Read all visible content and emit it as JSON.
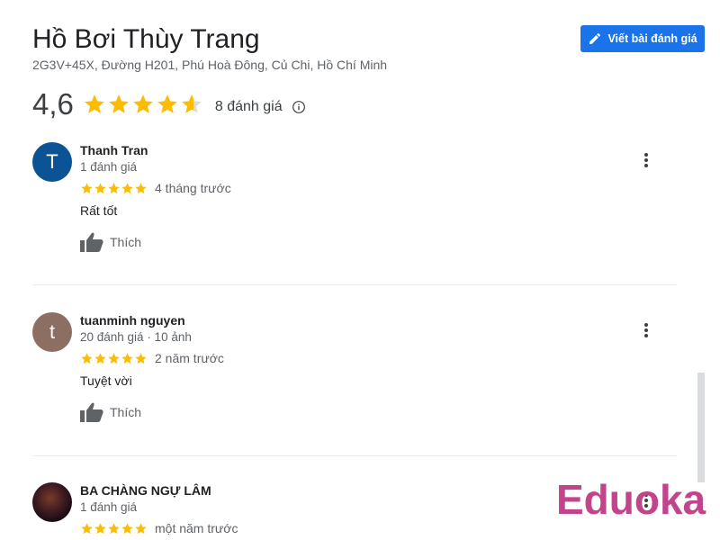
{
  "place": {
    "title": "Hồ Bơi Thùy Trang",
    "address": "2G3V+45X, Đường H201, Phú Hoà Đông, Củ Chi, Hồ Chí Minh"
  },
  "write_review_label": "Viết bài đánh giá",
  "rating": {
    "value_text": "4,6",
    "value": 4.6,
    "max": 5,
    "count_label": "8 đánh giá"
  },
  "like_label": "Thích",
  "reviews": [
    {
      "avatar_letter": "T",
      "avatar_color": "#0b5394",
      "name": "Thanh Tran",
      "meta": "1 đánh giá",
      "stars": 5,
      "time": "4 tháng trước",
      "text": "Rất tốt"
    },
    {
      "avatar_letter": "t",
      "avatar_color": "#8d6e63",
      "name": "tuanminh nguyen",
      "meta": "20 đánh giá · 10 ảnh",
      "stars": 5,
      "time": "2 năm trước",
      "text": "Tuyệt vời"
    },
    {
      "avatar_letter": "",
      "avatar_color": "#2a1418",
      "name": "BA CHÀNG NGỰ LÂM",
      "meta": "1 đánh giá",
      "stars": 5,
      "time": "một năm trước",
      "text": ""
    }
  ],
  "watermark": "Eduoka",
  "colors": {
    "star": "#fbbc04",
    "star_empty": "#dadce0",
    "accent": "#1a73e8"
  }
}
